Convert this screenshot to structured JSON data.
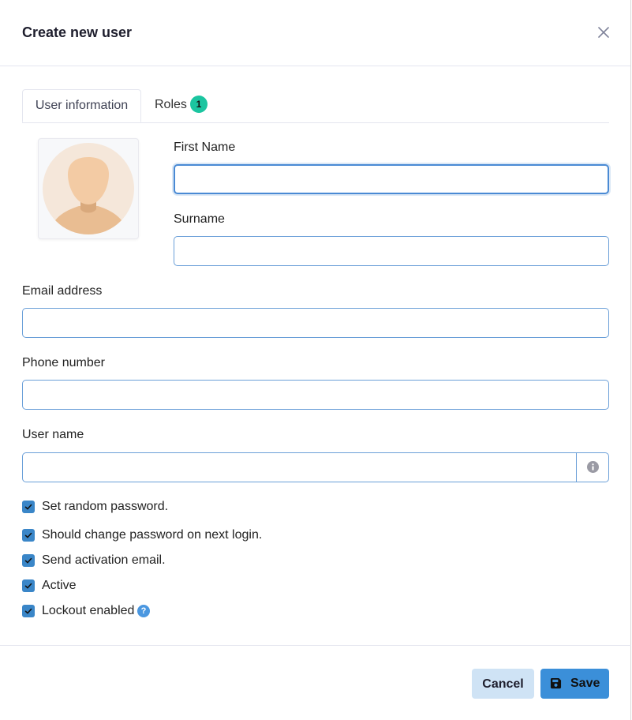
{
  "modal": {
    "title": "Create new user",
    "close_icon": "close-icon"
  },
  "tabs": [
    {
      "label": "User information",
      "active": true
    },
    {
      "label": "Roles",
      "badge": "1",
      "active": false
    }
  ],
  "form": {
    "first_name": {
      "label": "First Name",
      "value": "",
      "placeholder": ""
    },
    "surname": {
      "label": "Surname",
      "value": "",
      "placeholder": ""
    },
    "email": {
      "label": "Email address",
      "value": "",
      "placeholder": ""
    },
    "phone": {
      "label": "Phone number",
      "value": "",
      "placeholder": ""
    },
    "username": {
      "label": "User name",
      "value": "",
      "placeholder": "",
      "addon_icon": "info-icon"
    }
  },
  "options": [
    {
      "label": "Set random password.",
      "checked": true
    },
    {
      "label": "Should change password on next login.",
      "checked": true
    },
    {
      "label": "Send activation email.",
      "checked": true
    },
    {
      "label": "Active",
      "checked": true
    },
    {
      "label": "Lockout enabled",
      "checked": true,
      "help_icon": "question-icon",
      "help_glyph": "?"
    }
  ],
  "footer": {
    "cancel_label": "Cancel",
    "save_label": "Save",
    "save_icon": "floppy-disk-icon"
  },
  "colors": {
    "primary": "#3b8fd9",
    "cancel_bg": "#cfe3f5",
    "badge": "#1bc5a0",
    "checkbox": "#3a86c8",
    "input_border": "#6a9fd8"
  }
}
